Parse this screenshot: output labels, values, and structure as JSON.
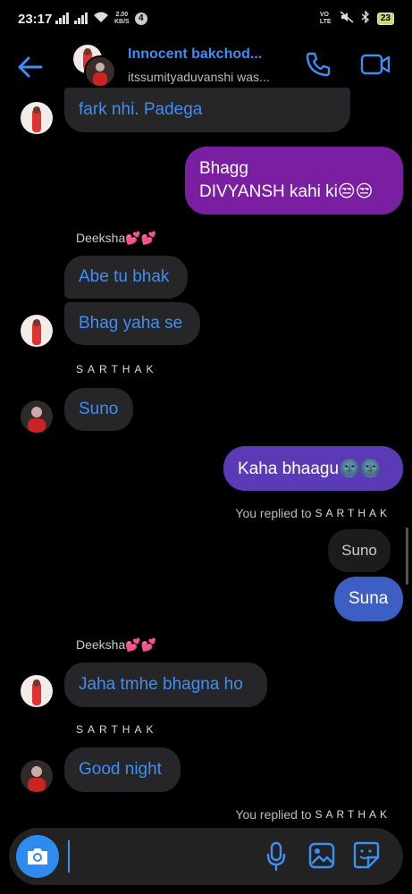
{
  "status_bar": {
    "time": "23:17",
    "net_speed_top": "2.00",
    "net_speed_unit": "KB/S",
    "notif_count": "4",
    "volte": "VO LTE",
    "battery": "23"
  },
  "header": {
    "title": "Innocent bakchod...",
    "subtitle": "itssumityaduvanshi was..."
  },
  "messages": {
    "m1": "fark nhi. Padega",
    "m2_line1": "Bhagg",
    "m2_line2": "DIVYANSH kahi ki😒😒",
    "sender_deeksha_1": "Deeksha💕💕",
    "m3": "Abe tu bhak",
    "m4": "Bhag yaha se",
    "sender_sarthak_1": "SARTHAK",
    "m5": "Suno",
    "m6": "Kaha bhaagu🌚🌚",
    "replied_1_prefix": "You replied to",
    "replied_1_name": "SARTHAK",
    "m7_quoted": "Suno",
    "m8": "Suna",
    "sender_deeksha_2": "Deeksha💕💕",
    "m9": "Jaha tmhe bhagna ho",
    "sender_sarthak_2": "SARTHAK",
    "m10": "Good night",
    "replied_2_prefix": "You replied to",
    "replied_2_name": "SARTHAK"
  },
  "composer": {
    "input_value": "",
    "input_placeholder": ""
  },
  "colors": {
    "accent_blue": "#3e8ef3",
    "purple_bubble": "#7b1fa2",
    "violet_bubble": "#5a3ab5",
    "blue_bubble": "#3d5fc4",
    "incoming_bubble": "#262628"
  },
  "icons": [
    "back-arrow-icon",
    "phone-icon",
    "video-camera-icon",
    "camera-icon",
    "microphone-icon",
    "gallery-icon",
    "sticker-icon"
  ]
}
